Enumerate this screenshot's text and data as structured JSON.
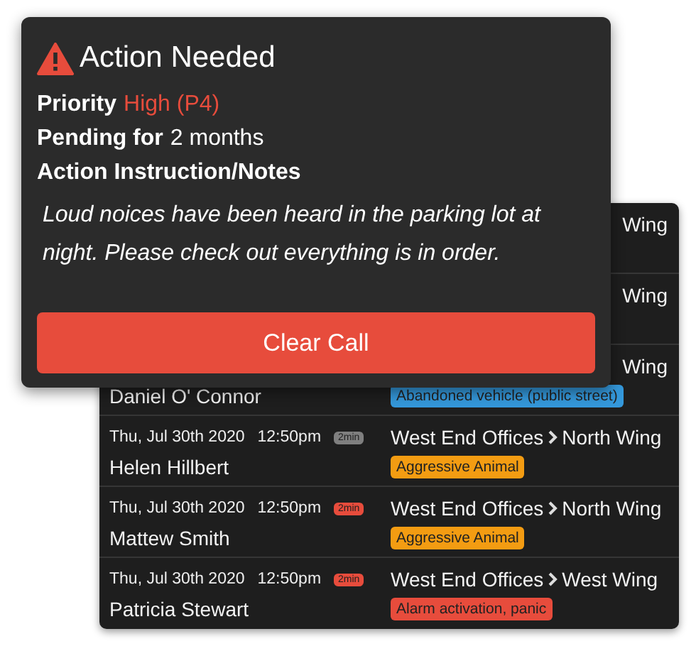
{
  "popup": {
    "title": "Action Needed",
    "priority": {
      "label": "Priority",
      "value": "High (P4)"
    },
    "pending": {
      "label": "Pending for",
      "value": "2 months"
    },
    "notes_label": "Action Instruction/Notes",
    "notes": "Loud noices have been heard in the parking lot at night. Please check out everything is in order.",
    "button": "Clear Call"
  },
  "rows": [
    {
      "location": [
        "Wing"
      ]
    },
    {
      "location": [
        "Wing"
      ]
    },
    {
      "name": "Daniel O' Connor",
      "location": [
        "Wing"
      ],
      "tag": {
        "label": "Abandoned vehicle (public street)",
        "color": "#3498db"
      }
    },
    {
      "date": "Thu, Jul 30th 2020",
      "time": "12:50pm",
      "badge": {
        "label": "2min",
        "color": "#7f7f7f"
      },
      "name": "Helen Hillbert",
      "location": [
        "West End Offices",
        "North Wing"
      ],
      "tag": {
        "label": "Aggressive Animal",
        "color": "#f39c12"
      }
    },
    {
      "date": "Thu, Jul 30th 2020",
      "time": "12:50pm",
      "badge": {
        "label": "2min",
        "color": "#e74c3c"
      },
      "name": "Mattew Smith",
      "location": [
        "West End Offices",
        "North Wing"
      ],
      "tag": {
        "label": "Aggressive Animal",
        "color": "#f39c12"
      }
    },
    {
      "date": "Thu, Jul 30th 2020",
      "time": "12:50pm",
      "badge": {
        "label": "2min",
        "color": "#e74c3c"
      },
      "name": "Patricia Stewart",
      "location": [
        "West End Offices",
        "West Wing"
      ],
      "tag": {
        "label": "Alarm activation, panic",
        "color": "#e74c3c"
      }
    }
  ]
}
